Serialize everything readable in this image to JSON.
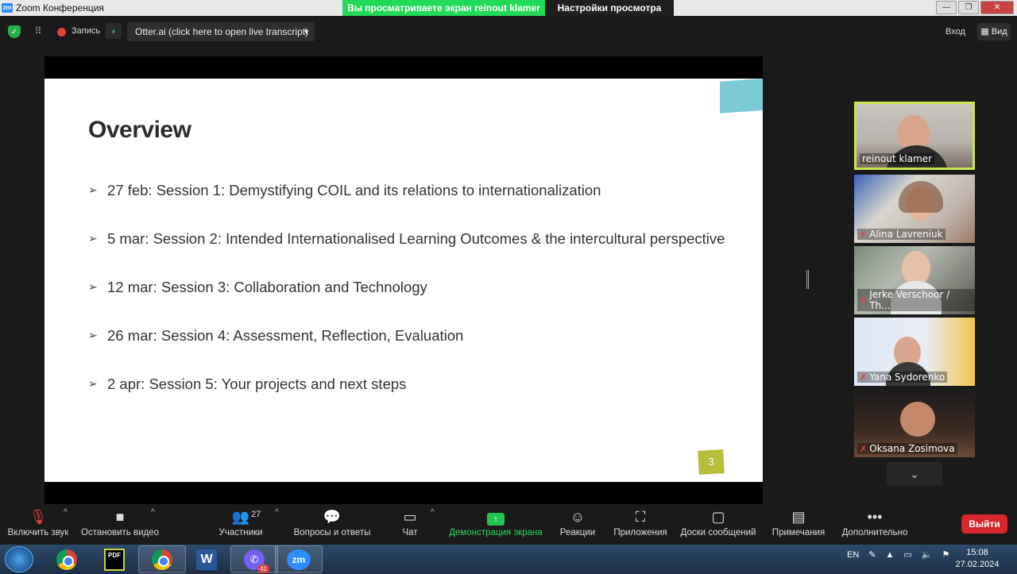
{
  "window": {
    "title": "Zoom Конференция",
    "logo": "zm",
    "share_banner": "Вы просматриваете экран reinout klamer",
    "view_settings": "Настройки просмотра"
  },
  "topbar": {
    "recording_label": "Запись",
    "otter_label": "Otter.ai (click here to open live transcript)",
    "login_label": "Вход",
    "view_label": "Вид"
  },
  "slide": {
    "title": "Overview",
    "bullets": [
      "27 feb: Session 1: Demystifying COIL and its relations to internationalization",
      "5 mar: Session 2: Intended Internationalised Learning Outcomes & the intercultural perspective",
      "12 mar: Session 3: Collaboration and Technology",
      "26 mar: Session 4: Assessment, Reflection, Evaluation",
      "2 apr: Session 5: Your projects and next steps"
    ],
    "page_number": "3",
    "accent_color": "#7ccbd6",
    "page_badge_color": "#b7be3b"
  },
  "participants": [
    {
      "name": "reinout klamer",
      "active": true
    },
    {
      "name": "Alina Lavreniuk",
      "muted": true
    },
    {
      "name": "Jerke Verschoor / Th...",
      "muted": true
    },
    {
      "name": "Yana Sydorenko",
      "muted": true
    },
    {
      "name": "Oksana Zosimova",
      "muted": true
    }
  ],
  "toolbar": {
    "unmute": "Включить звук",
    "stop_video": "Остановить видео",
    "participants": "Участники",
    "participants_count": "27",
    "qa": "Вопросы и ответы",
    "chat": "Чат",
    "share": "Демонстрация экрана",
    "reactions": "Реакции",
    "apps": "Приложения",
    "whiteboards": "Доски сообщений",
    "notes": "Примечания",
    "more": "Дополнительно",
    "leave": "Выйти"
  },
  "taskbar": {
    "viber_badge": "41",
    "pdf_label": "PDF",
    "word_label": "W",
    "zoom_label": "zm",
    "language": "EN",
    "time": "15:08",
    "date": "27.02.2024"
  },
  "colors": {
    "share_banner": "#23d959",
    "leave": "#d9262c",
    "active_speaker": "#c9e74e"
  }
}
